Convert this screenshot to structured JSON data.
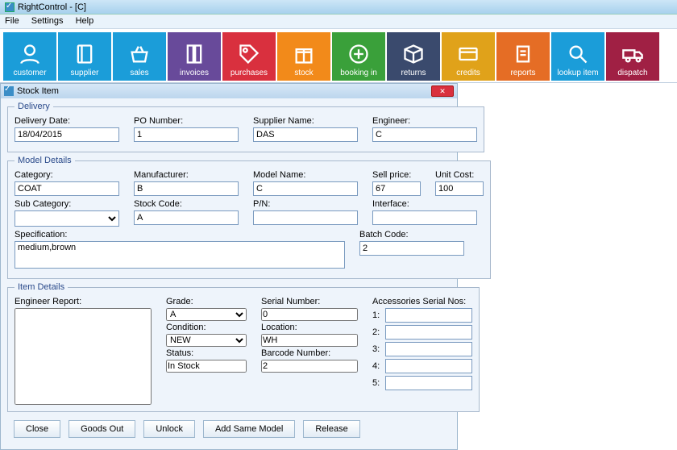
{
  "app": {
    "title": "RightControl - [C]"
  },
  "menu": {
    "file": "File",
    "settings": "Settings",
    "help": "Help"
  },
  "toolbar": [
    {
      "label": "customer",
      "color": "c-blue",
      "icon": "person"
    },
    {
      "label": "supplier",
      "color": "c-blue",
      "icon": "book"
    },
    {
      "label": "sales",
      "color": "c-blue",
      "icon": "basket"
    },
    {
      "label": "invoices",
      "color": "c-purple",
      "icon": "files"
    },
    {
      "label": "purchases",
      "color": "c-red",
      "icon": "tag"
    },
    {
      "label": "stock",
      "color": "c-orange",
      "icon": "gift"
    },
    {
      "label": "booking in",
      "color": "c-dgreen",
      "icon": "plus"
    },
    {
      "label": "returns",
      "color": "c-navy",
      "icon": "box"
    },
    {
      "label": "credits",
      "color": "c-gold",
      "icon": "card"
    },
    {
      "label": "reports",
      "color": "c-dorg",
      "icon": "clip"
    },
    {
      "label": "lookup item",
      "color": "c-teal",
      "icon": "search"
    },
    {
      "label": "dispatch",
      "color": "c-maroon",
      "icon": "truck"
    }
  ],
  "window": {
    "title": "Stock Item"
  },
  "delivery": {
    "legend": "Delivery",
    "date_label": "Delivery Date:",
    "date": "18/04/2015",
    "po_label": "PO Number:",
    "po": "1",
    "supplier_label": "Supplier Name:",
    "supplier": "DAS",
    "engineer_label": "Engineer:",
    "engineer": "C"
  },
  "model": {
    "legend": "Model Details",
    "category_label": "Category:",
    "category": "COAT",
    "manufacturer_label": "Manufacturer:",
    "manufacturer": "B",
    "modelname_label": "Model Name:",
    "modelname": "C",
    "sellprice_label": "Sell price:",
    "sellprice": "67",
    "unitcost_label": "Unit Cost:",
    "unitcost": "100",
    "subcat_label": "Sub Category:",
    "subcat": "",
    "stockcode_label": "Stock Code:",
    "stockcode": "A",
    "pn_label": "P/N:",
    "pn": "",
    "interface_label": "Interface:",
    "interface": "",
    "spec_label": "Specification:",
    "spec": "medium,brown",
    "batch_label": "Batch Code:",
    "batch": "2"
  },
  "item": {
    "legend": "Item Details",
    "er_label": "Engineer Report:",
    "er": "",
    "grade_label": "Grade:",
    "grade": "A",
    "condition_label": "Condition:",
    "condition": "NEW",
    "status_label": "Status:",
    "status": "In Stock",
    "serial_label": "Serial Number:",
    "serial": "0",
    "location_label": "Location:",
    "location": "WH",
    "barcode_label": "Barcode Number:",
    "barcode": "2",
    "acc_label": "Accessories Serial Nos:",
    "acc": [
      "",
      "",
      "",
      "",
      ""
    ]
  },
  "buttons": {
    "close": "Close",
    "goodsout": "Goods Out",
    "unlock": "Unlock",
    "addsame": "Add Same Model",
    "release": "Release"
  }
}
